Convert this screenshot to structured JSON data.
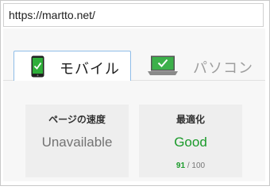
{
  "browser": {
    "url": "https://martto.net/"
  },
  "tabs": [
    {
      "label": "モバイル",
      "icon": "mobile-phone-icon",
      "active": true
    },
    {
      "label": "パソコン",
      "icon": "laptop-icon",
      "active": false
    }
  ],
  "cards": {
    "speed": {
      "title": "ページの速度",
      "value": "Unavailable"
    },
    "optimization": {
      "title": "最適化",
      "value": "Good",
      "score": "91",
      "score_max": "/ 100"
    }
  },
  "colors": {
    "good": "#1a9a2a",
    "active_tab_border": "#8fbde8",
    "unavailable": "#737373"
  }
}
